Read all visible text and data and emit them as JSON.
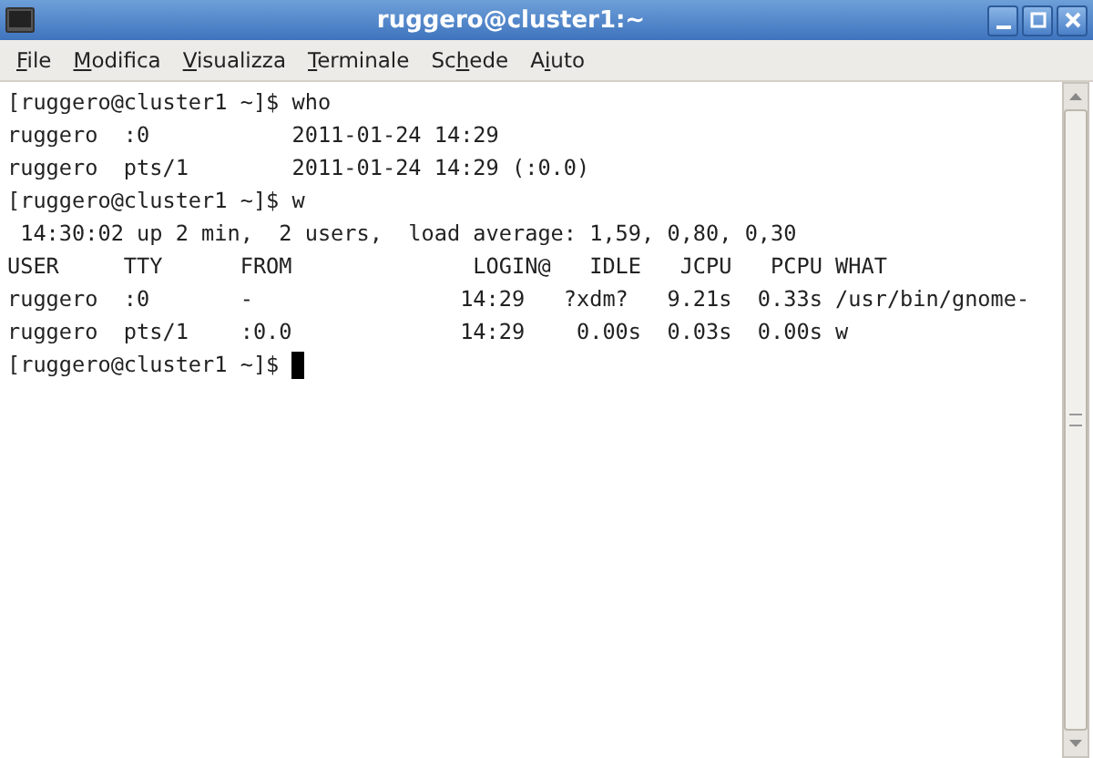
{
  "window": {
    "title": "ruggero@cluster1:~"
  },
  "menu": [
    {
      "key": "F",
      "after": "ile"
    },
    {
      "key": "M",
      "after": "odifica"
    },
    {
      "key": "V",
      "after": "isualizza"
    },
    {
      "key": "T",
      "after": "erminale"
    },
    {
      "before": "Sc",
      "key": "h",
      "after": "ede"
    },
    {
      "before": "A",
      "key": "i",
      "after": "uto"
    }
  ],
  "terminal": {
    "lines": [
      {
        "text": "[ruggero@cluster1 ~]$ who",
        "cursor": false
      },
      {
        "text": "ruggero  :0           2011-01-24 14:29",
        "cursor": false
      },
      {
        "text": "ruggero  pts/1        2011-01-24 14:29 (:0.0)",
        "cursor": false
      },
      {
        "text": "[ruggero@cluster1 ~]$ w",
        "cursor": false
      },
      {
        "text": " 14:30:02 up 2 min,  2 users,  load average: 1,59, 0,80, 0,30",
        "cursor": false
      },
      {
        "text": "USER     TTY      FROM              LOGIN@   IDLE   JCPU   PCPU WHAT",
        "cursor": false
      },
      {
        "text": "ruggero  :0       -                14:29   ?xdm?   9.21s  0.33s /usr/bin/gnome-",
        "cursor": false
      },
      {
        "text": "ruggero  pts/1    :0.0             14:29    0.00s  0.03s  0.00s w",
        "cursor": false
      },
      {
        "text": "[ruggero@cluster1 ~]$ ",
        "cursor": true
      }
    ]
  }
}
